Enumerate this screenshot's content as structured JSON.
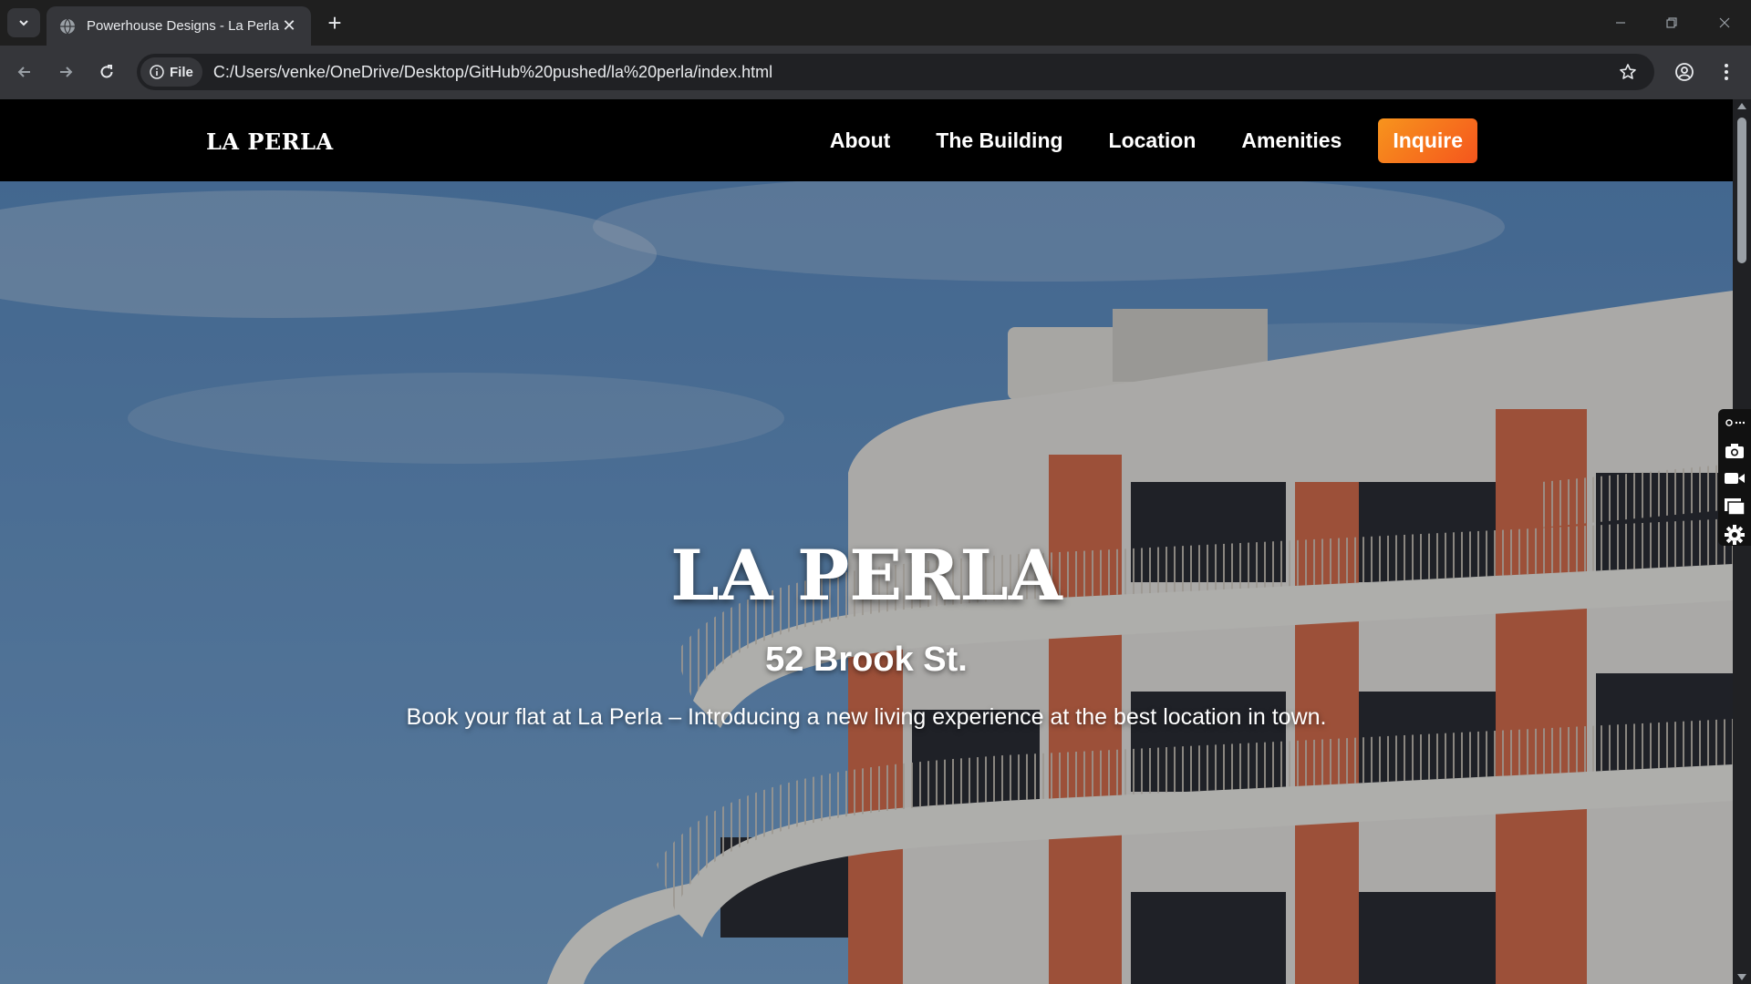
{
  "browser": {
    "tab_title": "Powerhouse Designs - La Perla",
    "tab_close": "✕",
    "new_tab": "+",
    "chip_label": "File",
    "url": "C:/Users/venke/OneDrive/Desktop/GitHub%20pushed/la%20perla/index.html",
    "icons": [
      "tab-search-icon",
      "globe-icon",
      "back-arrow-icon",
      "forward-arrow-icon",
      "reload-icon",
      "info-icon",
      "star-icon",
      "profile-icon",
      "menu-dots-icon",
      "minimize-icon",
      "restore-icon",
      "close-window-icon"
    ]
  },
  "site": {
    "logo": "LA PERLA",
    "nav": [
      {
        "label": "About"
      },
      {
        "label": "The Building"
      },
      {
        "label": "Location"
      },
      {
        "label": "Amenities"
      }
    ],
    "cta": "Inquire",
    "accent_gradient": [
      "#f7941d",
      "#f5561d"
    ]
  },
  "hero": {
    "title": "LA PERLA",
    "subtitle": "52 Brook St.",
    "description": "Book your flat at La Perla – Introducing a new living experience at the best location in town."
  },
  "extension_panel": {
    "icons": [
      "pin-icon",
      "camera-icon",
      "video-icon",
      "windows-icon",
      "settings-gear-icon"
    ]
  }
}
